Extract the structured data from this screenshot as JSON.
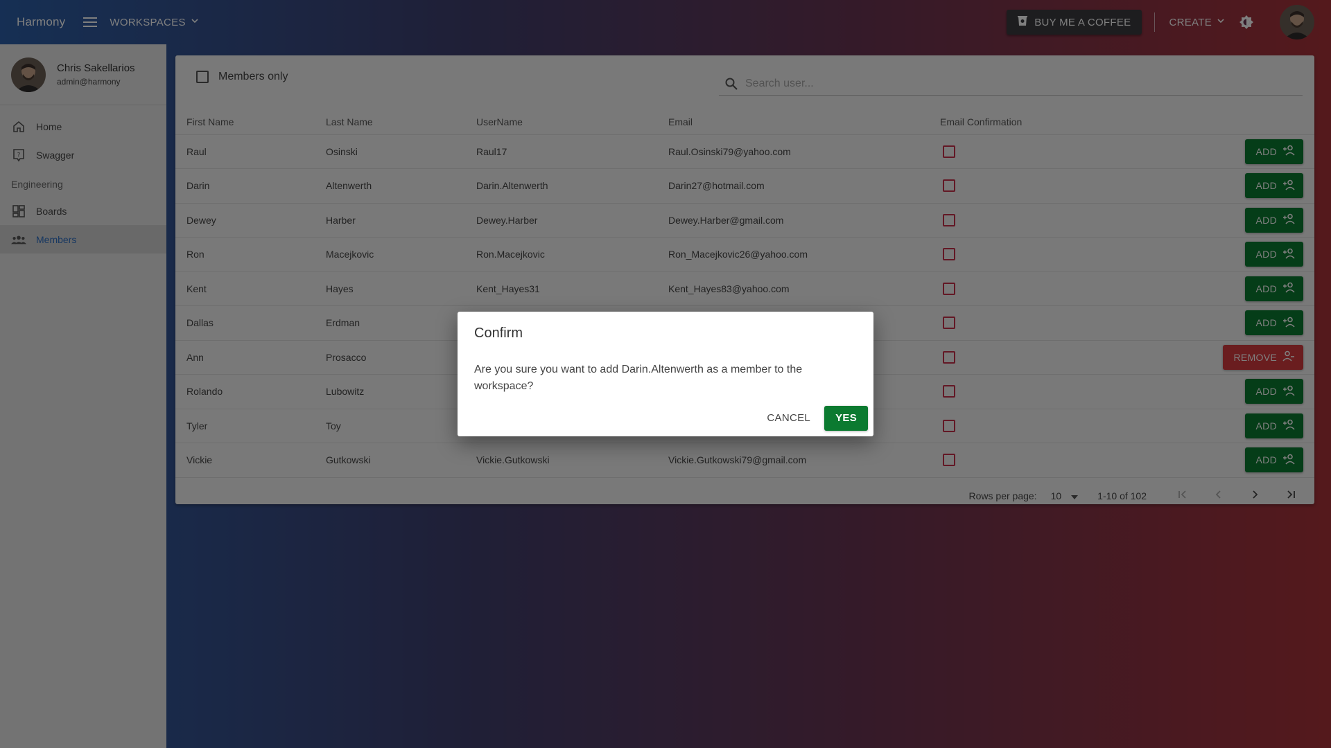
{
  "appbar": {
    "brand": "Harmony",
    "workspaces_label": "WORKSPACES",
    "coffee_label": "BUY ME A COFFEE",
    "create_label": "CREATE"
  },
  "sidebar": {
    "user_name": "Chris Sakellarios",
    "user_email": "admin@harmony",
    "items_top": [
      {
        "label": "Home",
        "icon": "home-icon"
      },
      {
        "label": "Swagger",
        "icon": "help-icon"
      }
    ],
    "section_title": "Engineering",
    "items_section": [
      {
        "label": "Boards",
        "icon": "dashboard-icon"
      },
      {
        "label": "Members",
        "icon": "people-icon",
        "active": true
      }
    ]
  },
  "toolbar": {
    "members_only_label": "Members only",
    "search_placeholder": "Search user..."
  },
  "table": {
    "headers": [
      "First Name",
      "Last Name",
      "UserName",
      "Email",
      "Email Confirmation"
    ],
    "rows": [
      {
        "first": "Raul",
        "last": "Osinski",
        "username": "Raul17",
        "email": "Raul.Osinski79@yahoo.com",
        "action": "ADD"
      },
      {
        "first": "Darin",
        "last": "Altenwerth",
        "username": "Darin.Altenwerth",
        "email": "Darin27@hotmail.com",
        "action": "ADD"
      },
      {
        "first": "Dewey",
        "last": "Harber",
        "username": "Dewey.Harber",
        "email": "Dewey.Harber@gmail.com",
        "action": "ADD"
      },
      {
        "first": "Ron",
        "last": "Macejkovic",
        "username": "Ron.Macejkovic",
        "email": "Ron_Macejkovic26@yahoo.com",
        "action": "ADD"
      },
      {
        "first": "Kent",
        "last": "Hayes",
        "username": "Kent_Hayes31",
        "email": "Kent_Hayes83@yahoo.com",
        "action": "ADD"
      },
      {
        "first": "Dallas",
        "last": "Erdman",
        "username": "",
        "email": "",
        "action": "ADD"
      },
      {
        "first": "Ann",
        "last": "Prosacco",
        "username": "",
        "email": "",
        "action": "REMOVE"
      },
      {
        "first": "Rolando",
        "last": "Lubowitz",
        "username": "",
        "email": "",
        "action": "ADD"
      },
      {
        "first": "Tyler",
        "last": "Toy",
        "username": "",
        "email": "",
        "action": "ADD"
      },
      {
        "first": "Vickie",
        "last": "Gutkowski",
        "username": "Vickie.Gutkowski",
        "email": "Vickie.Gutkowski79@gmail.com",
        "action": "ADD"
      }
    ]
  },
  "pagination": {
    "rows_per_page_label": "Rows per page:",
    "rows_per_page_value": "10",
    "range_label": "1-10 of 102"
  },
  "dialog": {
    "title": "Confirm",
    "message": "Are you sure you want to add Darin.Altenwerth as a member to the workspace?",
    "cancel_label": "CANCEL",
    "yes_label": "YES"
  },
  "colors": {
    "add_button": "#0b7a30",
    "remove_button": "#d53a3e",
    "active_nav": "#2e6fc2",
    "checkbox_border": "#c6304a"
  }
}
